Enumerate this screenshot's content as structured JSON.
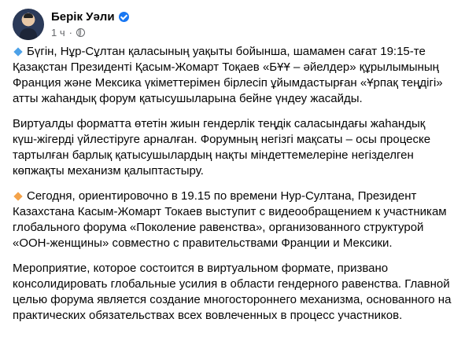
{
  "post": {
    "author": "Берік Уәли",
    "time": "1 ч",
    "separator": "·",
    "icons": {
      "verified": "verified-badge-icon",
      "audience": "globe-icon",
      "bullet_1": "small-blue-diamond",
      "bullet_2": "small-orange-diamond"
    },
    "colors": {
      "verified": "#1877f2",
      "bullet_1": "#4ca1e8",
      "bullet_2": "#f4a34a"
    },
    "paragraphs": [
      "Бүгін, Нұр-Сұлтан қаласының уақыты бойынша, шамамен сағат 19:15-те Қазақстан Президенті Қасым-Жомарт Тоқаев «БҰҰ – әйелдер» құрылымының Франция және Мексика үкіметтерімен бірлесіп ұйымдастырған «Ұрпақ теңдігі» атты жаһандық форум қатысушыларына бейне үндеу жасайды.",
      "Виртуалды форматта өтетін жиын гендерлік теңдік саласындағы жаһандық күш-жігерді үйлестіруге арналған. Форумның негізгі мақсаты – осы процеске тартылған барлық қатысушылардың нақты міндеттемелеріне негізделген көпжақты механизм қалыптастыру.",
      "Сегодня, ориентировочно в 19.15 по времени Нур-Султана, Президент Казахстана Касым-Жомарт Токаев выступит с видеообращением к участникам глобального форума «Поколение равенства», организованного структурой «ООН-женщины» совместно с правительствами Франции и Мексики.",
      "Мероприятие, которое состоится в виртуальном формате, призвано консолидировать глобальные усилия в области гендерного равенства. Главной целью форума является создание многостороннего механизма, основанного на практических обязательствах всех вовлеченных в процесс участников."
    ]
  }
}
